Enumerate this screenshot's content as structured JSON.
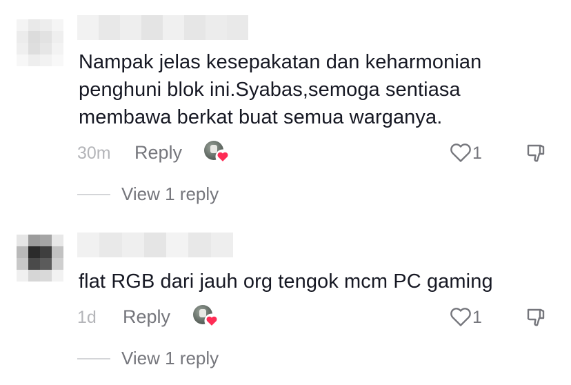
{
  "comments": [
    {
      "text_lines": [
        "Nampak jelas kesepakatan dan keharmonian",
        "penghuni blok ini.Syabas,semoga sentiasa",
        "membawa berkat buat semua warganya."
      ],
      "time": "30m",
      "reply_label": "Reply",
      "like_count": "1",
      "view_replies_label": "View 1 reply"
    },
    {
      "text_lines": [
        "flat RGB dari jauh org tengok mcm PC gaming"
      ],
      "time": "1d",
      "reply_label": "Reply",
      "like_count": "1",
      "view_replies_label": "View 1 reply"
    }
  ],
  "icons": {
    "like": "heart-outline-icon",
    "dislike": "thumbs-down-outline-icon",
    "creator_liked": "heart-badge-icon"
  },
  "colors": {
    "text": "#161823",
    "secondary": "#75767c",
    "time": "#b4b5b9",
    "creator_heart": "#fe2c55"
  }
}
